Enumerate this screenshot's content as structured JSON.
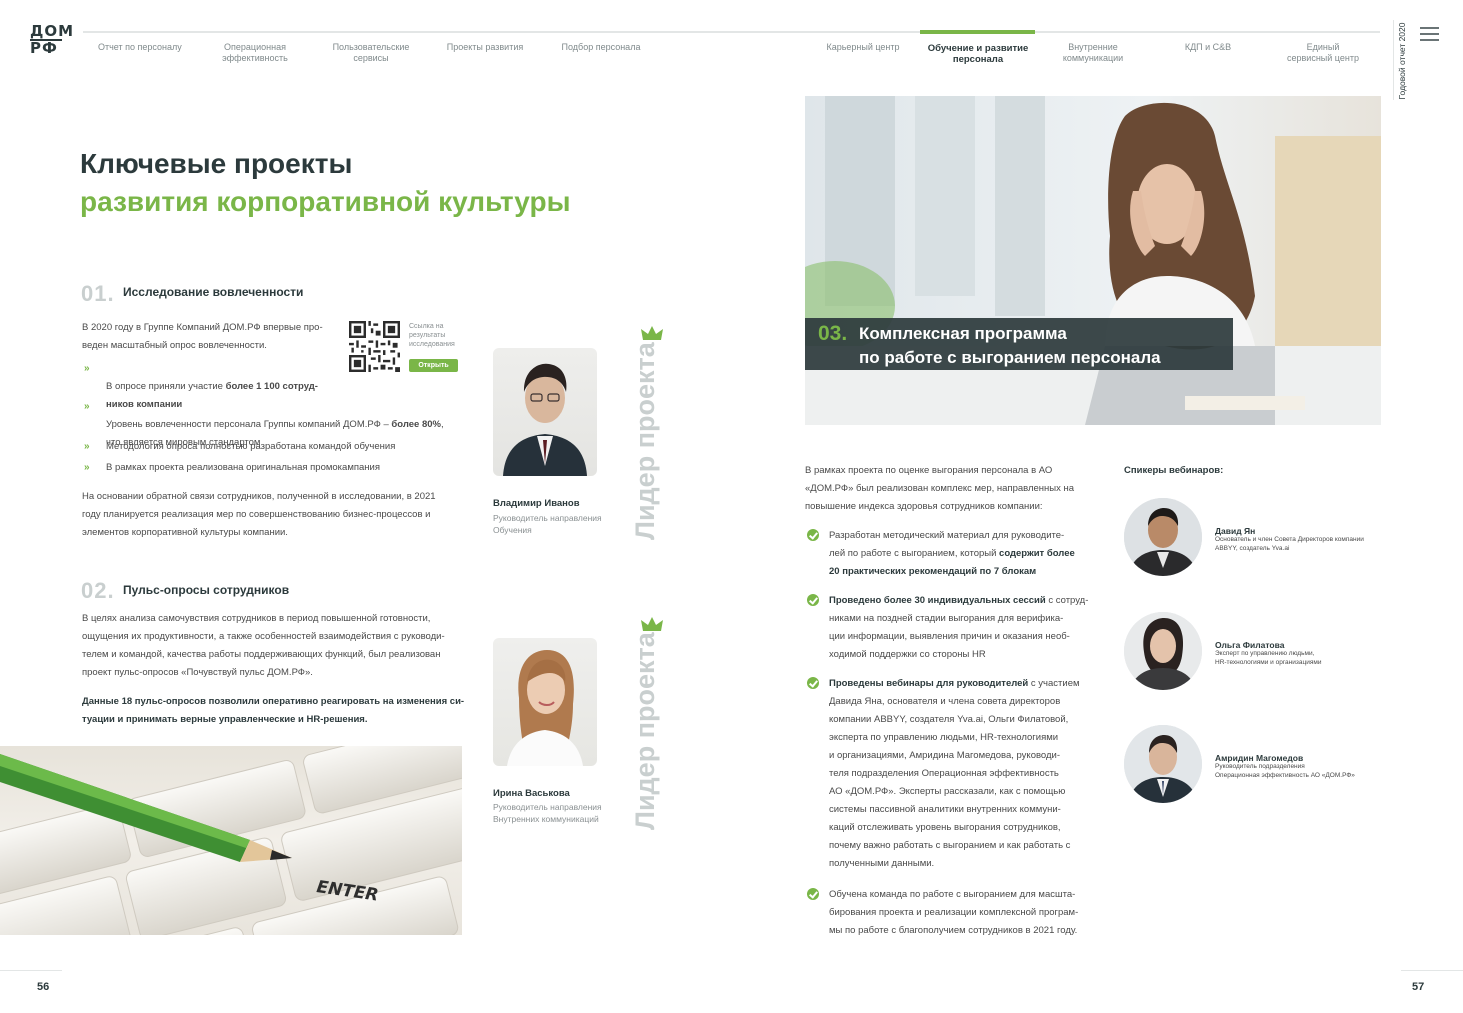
{
  "header": {
    "logo_top": "ДОМ",
    "logo_bottom": "РФ",
    "nav": [
      {
        "label": "Отчет по персоналу"
      },
      {
        "label": "Операционная\nэффективность"
      },
      {
        "label": "Пользовательские\nсервисы"
      },
      {
        "label": "Проекты развития"
      },
      {
        "label": "Подбор персонала"
      },
      {
        "label": "Карьерный центр"
      },
      {
        "label": "Обучение и развитие\nперсонала",
        "active": true
      },
      {
        "label": "Внутренние\nкоммуникации"
      },
      {
        "label": "КДП и C&B"
      },
      {
        "label": "Единый\nсервисный центр"
      }
    ],
    "side_label": "Годовой отчет 2020"
  },
  "left": {
    "title_line1": "Ключевые проекты",
    "title_line2": "развития корпоративной культуры",
    "s1": {
      "num": "01.",
      "title": "Исследование вовлеченности",
      "intro": "В 2020 году в Группе Компаний ДОМ.РФ впервые про-\nведен масштабный опрос вовлеченности.",
      "qr_caption": "Ссылка на\nрезультаты\nисследования",
      "qr_button": "Открыть",
      "bullet_marker": "»",
      "b1_pre": "В опросе приняли участие ",
      "b1_bold": "более 1 100 сотруд-\nников компании",
      "b2_pre": "Уровень вовлеченности персонала Группы компаний ДОМ.РФ – ",
      "b2_bold": "более 80%",
      "b2_post": ",\nчто является мировым стандартом",
      "b3": "Методология опроса полностью разработана командой обучения",
      "b4": "В рамках проекта реализована оригинальная промокампания",
      "outro": "На основании обратной связи сотрудников, полученной в исследовании, в 2021\nгоду планируется реализация мер по совершенствованию бизнес-процессов и\nэлементов корпоративной культуры компании."
    },
    "s2": {
      "num": "02.",
      "title": "Пульс-опросы сотрудников",
      "text": "В целях анализа самочувствия сотрудников в период повышенной готовности,\nощущения их продуктивности, а также особенностей взаимодействия с руководи-\nтелем и командой, качества работы поддерживающих функций, был реализован\nпроект пульс-опросов «Почувствуй пульс ДОМ.РФ».",
      "bold": "Данные 18 пульс-опросов позволили оперативно реагировать на изменения си-\nтуации и принимать верные управленческие и HR-решения."
    },
    "photo_key_label": "ENTER",
    "leaders": [
      {
        "name": "Владимир Иванов",
        "role": "Руководитель направления\nОбучения",
        "badge": "Лидер проекта"
      },
      {
        "name": "Ирина Васькова",
        "role": "Руководитель направления\nВнутренних коммуникаций",
        "badge": "Лидер проекта"
      }
    ],
    "page_number": "56"
  },
  "right": {
    "hero_num": "03.",
    "hero_title": "Комплексная программа\nпо работе с выгоранием персонала",
    "intro": "В рамках проекта по оценке выгорания персонала в АО\n«ДОМ.РФ» был реализован комплекс мер, направленных на\nповышение индекса здоровья сотрудников компании:",
    "c1_pre": "Разработан методический материал для руководите-\nлей по работе с выгоранием, который ",
    "c1_bold": "содержит более\n20 практических рекомендаций по 7 блокам",
    "c2_bold": "Проведено более 30 индивидуальных сессий",
    "c2_post": " с сотруд-\nниками на поздней стадии выгорания для верифика-\nции информации, выявления причин и оказания необ-\nходимой поддержки со стороны HR",
    "c3_bold": "Проведены вебинары для руководителей",
    "c3_post": " с участием\nДавида Яна, основателя и члена совета директоров\nкомпании ABBYY, создателя Yva.ai, Ольги Филатовой,\nэксперта по управлению людьми, HR-технологиями\nи организациями, Амридина Магомедова, руководи-\nтеля подразделения Операционная эффективность\nАО «ДОМ.РФ». Эксперты рассказали, как с помощью\nсистемы пассивной аналитики внутренних коммуни-\nкаций отслеживать уровень выгорания сотрудников,\nпочему важно работать с выгоранием и как работать с\nполученными данными.",
    "c4": "Обучена команда по работе с выгоранием для масшта-\nбирования проекта и реализации комплексной програм-\nмы по работе с благополучием сотрудников в 2021 году.",
    "speakers_title": "Спикеры вебинаров:",
    "speakers": [
      {
        "name": "Давид Ян",
        "role": "Основатель и член Совета Директоров компании\nABBYY, создатель Yva.ai"
      },
      {
        "name": "Ольга Филатова",
        "role": "Эксперт по управлению людьми,\nHR-технологиями и организациями"
      },
      {
        "name": "Амридин Магомедов",
        "role": "Руководитель подразделения\nОперационная эффективность АО «ДОМ.РФ»"
      }
    ],
    "page_number": "57"
  },
  "colors": {
    "accent": "#7ab648",
    "dark": "#2c3a3c",
    "muted": "#c9cfcf"
  }
}
